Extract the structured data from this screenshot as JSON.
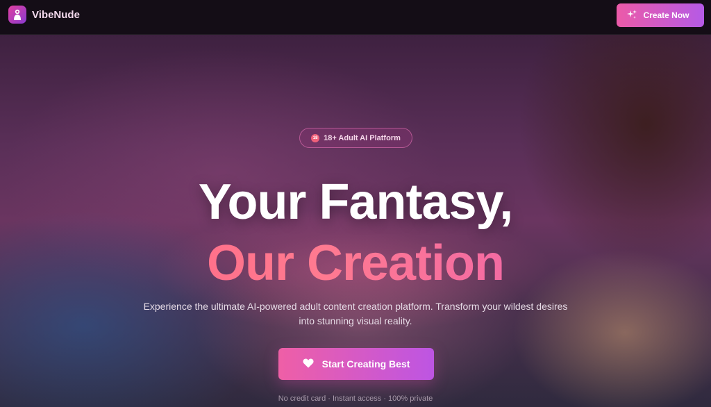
{
  "header": {
    "brand": "VibeNude",
    "create_now_label": "Create Now"
  },
  "hero": {
    "badge": "18+ Adult AI Platform",
    "badge_icon_text": "18",
    "title_line1": "Your Fantasy,",
    "title_line2": "Our Creation",
    "subtitle": "Experience the ultimate AI-powered adult content creation platform. Transform your wildest desires into stunning visual reality.",
    "cta_label": "Start Creating Best",
    "fineprint": "No credit card · Instant access · 100% private"
  },
  "icons": {
    "logo": "logo-mark-icon",
    "create_now": "sparkles-icon",
    "badge": "age-restriction-icon",
    "cta": "heart-icon"
  },
  "colors": {
    "accent_pink": "#ec5aa8",
    "accent_purple": "#b55ae6",
    "title_gradient_start": "#ff6080",
    "title_gradient_end": "#e85ab8"
  }
}
